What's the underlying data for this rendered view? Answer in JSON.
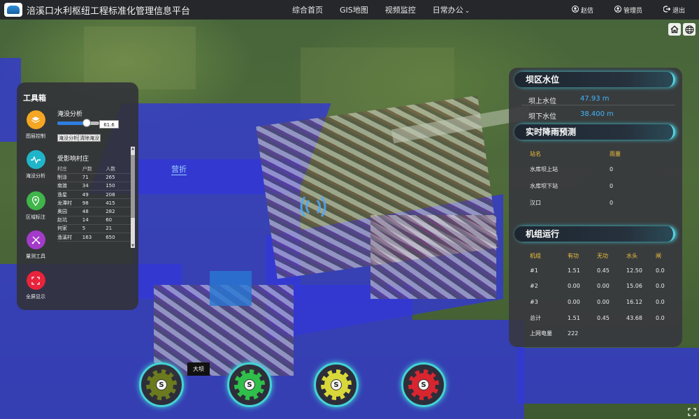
{
  "header": {
    "title": "涪溪口水利枢纽工程标准化管理信息平台",
    "nav": [
      {
        "label": "综合首页"
      },
      {
        "label": "GIS地图"
      },
      {
        "label": "视频监控"
      },
      {
        "label": "日常办公",
        "chevron": "⌄"
      }
    ],
    "user": {
      "name": "赵佶",
      "role": "管理员",
      "logout": "退出"
    }
  },
  "map": {
    "label": "营折",
    "buttons": [
      {
        "icon": "home-icon"
      },
      {
        "icon": "globe-icon"
      }
    ]
  },
  "toolbox": {
    "title": "工具箱",
    "tools": [
      {
        "label": "图层控制",
        "icon": "layers-icon",
        "color": "#f5a623"
      },
      {
        "label": "淹没分析",
        "icon": "wave-icon",
        "color": "#1fb5c9"
      },
      {
        "label": "区域标注",
        "icon": "location-pin-icon",
        "color": "#3fb54a"
      },
      {
        "label": "量测工具",
        "icon": "measure-icon",
        "color": "#a33bc9"
      },
      {
        "label": "全屏显示",
        "icon": "fullscreen-icon",
        "color": "#e8233b"
      }
    ],
    "flood_analysis": {
      "title": "淹没分析",
      "level_value": "61.6",
      "level_fraction": 0.7,
      "analyze_button": "淹没分析",
      "clear_button": "清除淹没"
    },
    "affected": {
      "title": "受影响村庄",
      "headers": [
        "村庄",
        "户数",
        "人数"
      ],
      "rows": [
        [
          "制涂",
          "71",
          "265"
        ],
        [
          "南渡",
          "34",
          "150"
        ],
        [
          "渔星",
          "49",
          "208"
        ],
        [
          "龙潭村",
          "98",
          "415"
        ],
        [
          "奥园",
          "48",
          "282"
        ],
        [
          "赵坑",
          "14",
          "60"
        ],
        [
          "何家",
          "5",
          "21"
        ],
        [
          "渔溪村",
          "163",
          "650"
        ]
      ]
    }
  },
  "water_level": {
    "title": "坝区水位",
    "upstream_label": "坝上水位",
    "upstream_value": "47.93 m",
    "downstream_label": "坝下水位",
    "downstream_value": "38.400 m"
  },
  "rain_forecast": {
    "title": "实时降雨预测",
    "headers": [
      "站名",
      "雨量"
    ],
    "rows": [
      [
        "水库坝上站",
        "0"
      ],
      [
        "水库坝下站",
        "0"
      ],
      [
        "汉口",
        "0"
      ]
    ]
  },
  "unit_operation": {
    "title": "机组运行",
    "headers": [
      "机组",
      "有功",
      "无功",
      "水头",
      "闸"
    ],
    "rows": [
      [
        "#1",
        "1.51",
        "0.45",
        "12.50",
        "0.0"
      ],
      [
        "#2",
        "0.00",
        "0.00",
        "15.06",
        "0.0"
      ],
      [
        "#3",
        "0.00",
        "0.00",
        "16.12",
        "0.0"
      ],
      [
        "总计",
        "1.51",
        "0.45",
        "43.68",
        "0.0"
      ]
    ],
    "partial_row": [
      "上网电量",
      "222"
    ]
  },
  "bottom_buttons": [
    {
      "symbol": "S",
      "color": "#6b7a1e"
    },
    {
      "symbol": "S",
      "color": "#2fbf4a"
    },
    {
      "symbol": "S",
      "color": "#d8d83a"
    },
    {
      "symbol": "S",
      "color": "#d8252f"
    }
  ],
  "tooltip": "大坝"
}
